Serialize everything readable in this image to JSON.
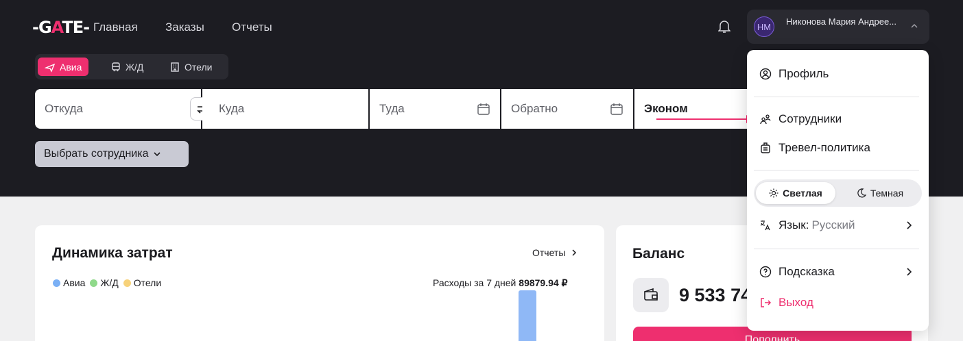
{
  "header": {
    "logo": {
      "part1": "-G",
      "accent": "A",
      "part2": "TE-"
    },
    "nav": [
      "Главная",
      "Заказы",
      "Отчеты"
    ],
    "user": {
      "initials": "НМ",
      "name": "Никонова Мария Андрее..."
    }
  },
  "search": {
    "modes": [
      "Авиа",
      "Ж/Д",
      "Отели"
    ],
    "active_mode": "Авиа",
    "from_placeholder": "Откуда",
    "to_placeholder": "Куда",
    "depart_placeholder": "Туда",
    "return_placeholder": "Обратно",
    "class_value": "Эконом",
    "employee_button": "Выбрать сотрудника"
  },
  "cost_card": {
    "title": "Динамика затрат",
    "reports_link": "Отчеты",
    "legend": [
      {
        "label": "Авиа",
        "color": "#7ab0f5"
      },
      {
        "label": "Ж/Д",
        "color": "#8fd98a"
      },
      {
        "label": "Отели",
        "color": "#f7d27a"
      }
    ],
    "spend_label": "Расходы за 7 дней",
    "spend_value": "89879.94 ₽"
  },
  "balance_card": {
    "title": "Баланс",
    "amount": "9 533 74",
    "topup_label": "Пополнить"
  },
  "dropdown": {
    "profile": "Профиль",
    "employees": "Сотрудники",
    "travel_policy": "Тревел-политика",
    "theme_light": "Светлая",
    "theme_dark": "Темная",
    "language_label": "Язык:",
    "language_value": "Русский",
    "hint": "Подсказка",
    "logout": "Выход"
  },
  "colors": {
    "accent": "#ee2f6f",
    "header_bg": "#1c1c22"
  }
}
